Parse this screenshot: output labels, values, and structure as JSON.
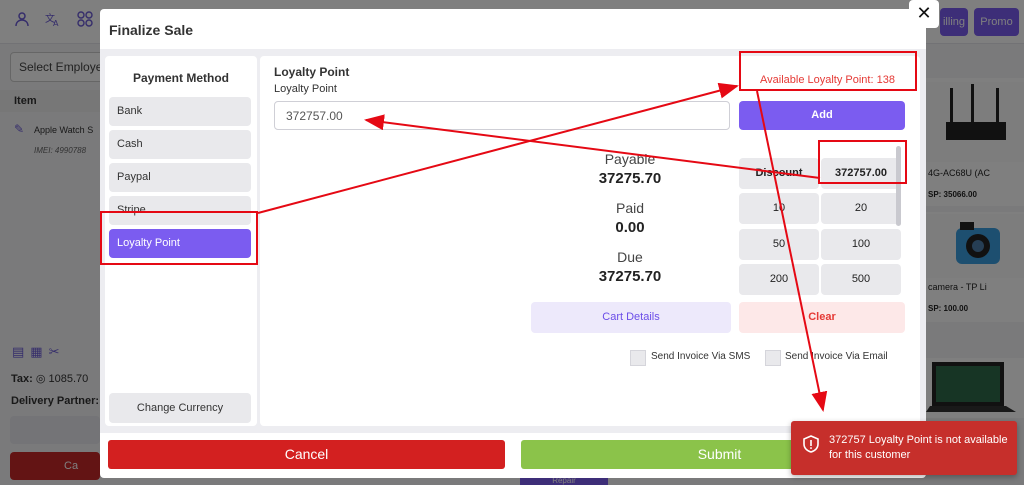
{
  "background": {
    "topbar_buttons": [
      "illing",
      "Promo"
    ],
    "employee_select_placeholder": "Select Employe",
    "item_header": "Item",
    "item_name": "Apple Watch S",
    "item_imei": "IMEI: 4990788",
    "tax_label": "Tax:",
    "tax_value": "1085.70",
    "delivery_label": "Delivery Partner:",
    "cancel_label": "Ca",
    "repair_label": "Repair",
    "products": [
      {
        "name": "4G-AC68U (AC",
        "price": "SP: 35066.00"
      },
      {
        "name": "camera - TP Li",
        "price": "SP: 100.00"
      }
    ]
  },
  "modal": {
    "title": "Finalize Sale",
    "close_symbol": "✕",
    "payment_method": {
      "title": "Payment Method",
      "items": [
        "Bank",
        "Cash",
        "Paypal",
        "Stripe",
        "Loyalty Point"
      ],
      "active": "Loyalty Point",
      "change_currency": "Change Currency"
    },
    "loyalty": {
      "heading": "Loyalty Point",
      "label": "Loyalty Point",
      "input_value": "372757.00",
      "available_text": "Available Loyalty Point: 138",
      "add_label": "Add"
    },
    "summary": {
      "payable_label": "Payable",
      "payable_value": "37275.70",
      "paid_label": "Paid",
      "paid_value": "0.00",
      "due_label": "Due",
      "due_value": "37275.70"
    },
    "keypad": {
      "discount_label": "Discount",
      "amount_display": "372757.00",
      "keys": [
        "10",
        "20",
        "50",
        "100",
        "200",
        "500"
      ]
    },
    "cart_details_label": "Cart Details",
    "clear_label": "Clear",
    "send_sms_label": "Send Invoice Via SMS",
    "send_email_label": "Send Invoice Via Email",
    "cancel_label": "Cancel",
    "submit_label": "Submit"
  },
  "toast": {
    "message": "372757 Loyalty Point is not available for this customer",
    "icon": "shield-alert-icon",
    "color": "#c62f2b"
  },
  "colors": {
    "accent": "#7b5cf0",
    "danger": "#d32020",
    "success": "#8bc34a",
    "annotation": "#e50914"
  }
}
